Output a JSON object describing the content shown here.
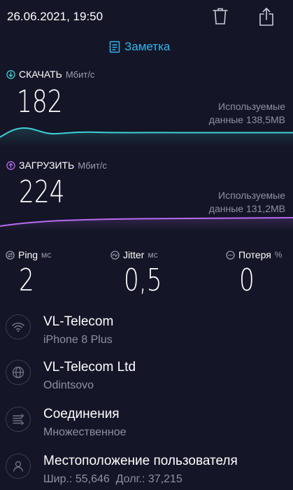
{
  "header": {
    "datetime": "26.06.2021, 19:50"
  },
  "note": {
    "label": "Заметка"
  },
  "download": {
    "label": "СКАЧАТЬ",
    "unit": "Мбит/с",
    "value": "182",
    "used_line1": "Используемые",
    "used_line2": "данные 138,5MB",
    "color": "#3ed0d6"
  },
  "upload": {
    "label": "ЗАГРУЗИТЬ",
    "unit": "Мбит/с",
    "value": "224",
    "used_line1": "Используемые",
    "used_line2": "данные 131,2MB",
    "color": "#b76bf2"
  },
  "metrics": {
    "ping": {
      "label": "Ping",
      "unit": "мс",
      "value": "2"
    },
    "jitter": {
      "label": "Jitter",
      "unit": "мс",
      "value": "0,5"
    },
    "loss": {
      "label": "Потеря",
      "unit": "%",
      "value": "0"
    }
  },
  "info": {
    "wifi": {
      "title": "VL-Telecom",
      "sub": "iPhone 8 Plus",
      "icon": "wifi-icon"
    },
    "server": {
      "title": "VL-Telecom Ltd",
      "sub": "Odintsovo",
      "icon": "globe-icon"
    },
    "connections": {
      "title": "Соединения",
      "sub": "Множественное",
      "icon": "connections-icon"
    },
    "location": {
      "title": "Местоположение пользователя",
      "sub": "Шир.: 55,646  Долг.: 37,215",
      "icon": "user-icon"
    }
  }
}
